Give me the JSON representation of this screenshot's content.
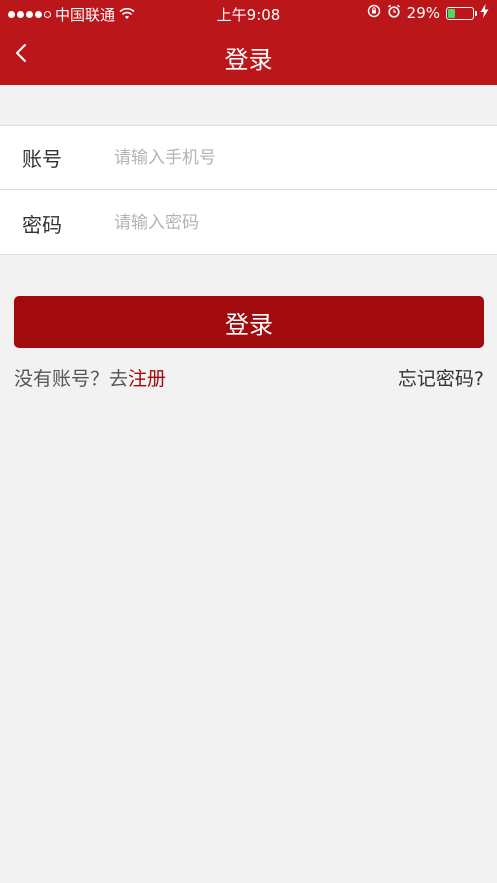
{
  "status_bar": {
    "carrier": "中国联通",
    "time": "上午9:08",
    "battery_percent": "29%",
    "battery_level": 0.29,
    "signal_icon": "signal-dots-icon",
    "wifi_icon": "wifi-icon",
    "lock_icon": "orientation-lock-icon",
    "alarm_icon": "alarm-icon",
    "charging_icon": "charging-bolt-icon"
  },
  "nav": {
    "title": "登录",
    "back_icon": "chevron-left-icon"
  },
  "form": {
    "account_label": "账号",
    "account_placeholder": "请输入手机号",
    "password_label": "密码",
    "password_placeholder": "请输入密码"
  },
  "actions": {
    "login_label": "登录",
    "register_prompt": "没有账号？去",
    "register_link": "注册",
    "forgot_link": "忘记密码?"
  },
  "colors": {
    "header_bg": "#bb161a",
    "button_bg": "#a10b0d",
    "page_bg": "#f2f2f2"
  }
}
